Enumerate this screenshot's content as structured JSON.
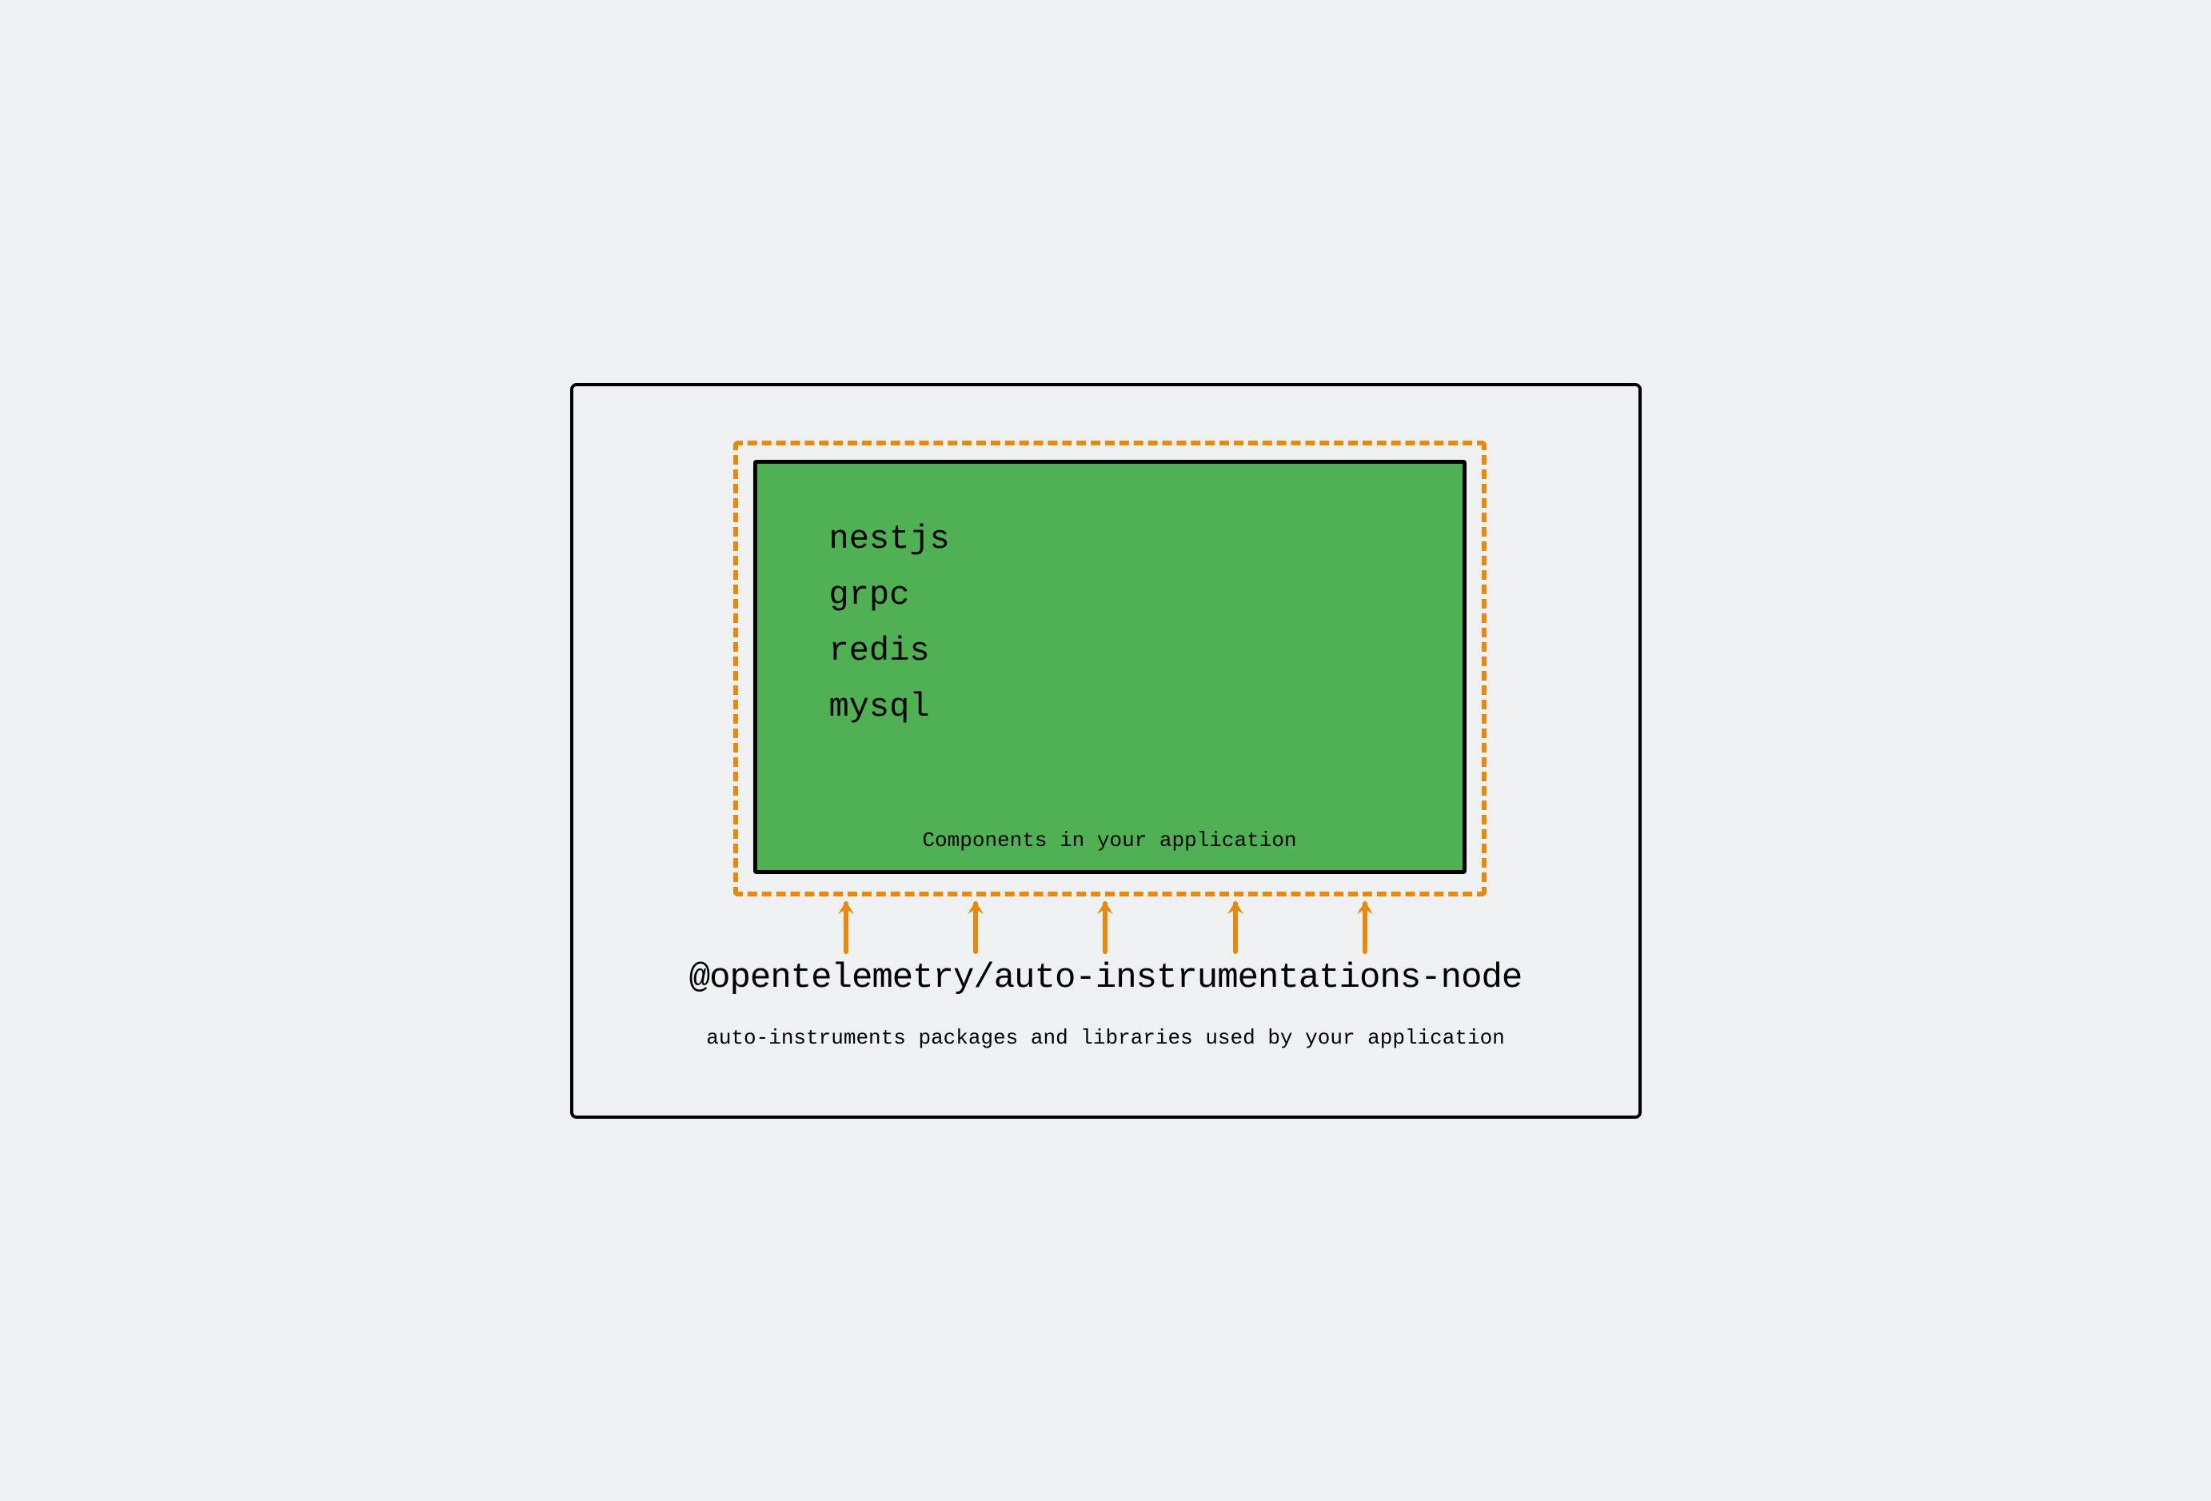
{
  "diagram": {
    "components": [
      "nestjs",
      "grpc",
      "redis",
      "mysql"
    ],
    "components_label": "Components in your application",
    "package_name": "@opentelemetry/auto-instrumentations-node",
    "description": "auto-instruments packages and libraries used by your application",
    "arrow_count": 5
  },
  "colors": {
    "background": "#eef0f2",
    "green_box": "#4fb154",
    "orange": "#e8890c",
    "black": "#000"
  }
}
